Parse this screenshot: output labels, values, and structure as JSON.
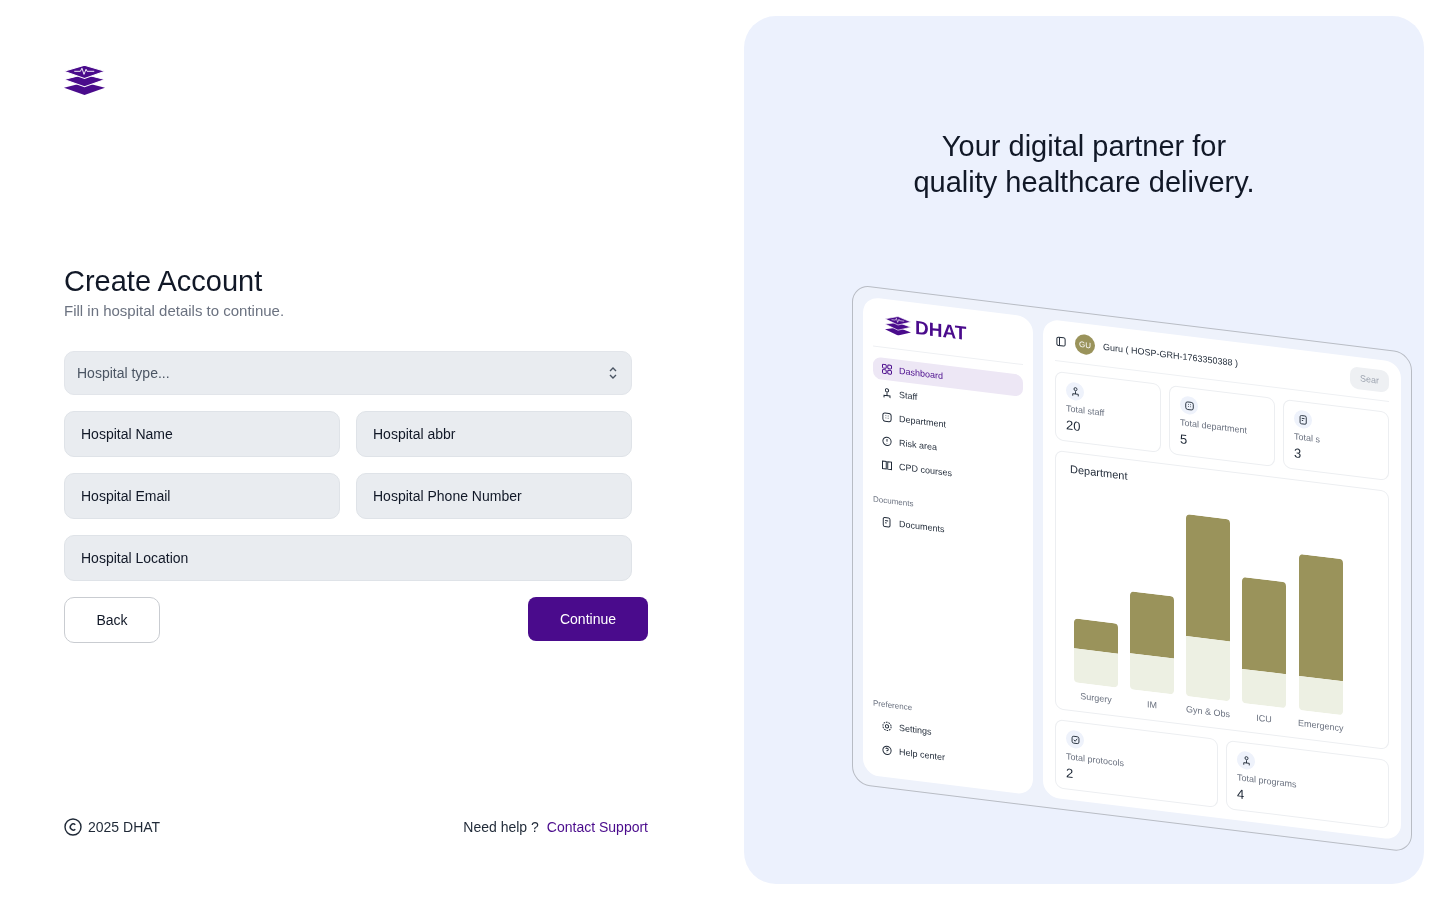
{
  "form": {
    "title": "Create Account",
    "subtitle": "Fill in hospital details to continue.",
    "select": {
      "placeholder": "Hospital type..."
    },
    "fields": [
      {
        "placeholder": "Hospital Name"
      },
      {
        "placeholder": "Hospital abbr"
      },
      {
        "placeholder": "Hospital Email"
      },
      {
        "placeholder": "Hospital Phone Number"
      },
      {
        "placeholder": "Hospital Location"
      }
    ],
    "back": "Back",
    "continue": "Continue"
  },
  "footer": {
    "copyright": "2025 DHAT",
    "help": "Need help ?",
    "link": "Contact Support"
  },
  "promo": {
    "tagline": [
      "Your digital partner for",
      "quality healthcare delivery."
    ],
    "preview": {
      "brand": "DHAT",
      "nav": [
        {
          "label": "Dashboard",
          "selected": true
        },
        {
          "label": "Staff",
          "selected": false
        },
        {
          "label": "Department",
          "selected": false
        },
        {
          "label": "Risk area",
          "selected": false
        },
        {
          "label": "CPD courses",
          "selected": false
        }
      ],
      "documents_heading": "Documents",
      "documents": [
        {
          "label": "Documents",
          "selected": false
        }
      ],
      "preference_heading": "Preference",
      "preference": [
        {
          "label": "Settings",
          "selected": false
        },
        {
          "label": "Help center",
          "selected": false
        }
      ],
      "avatar": "GU",
      "user": "Guru ( HOSP-GRH-1763350388 )",
      "search": "Sear",
      "stats": [
        {
          "label": "Total staff",
          "value": "20"
        },
        {
          "label": "Total department",
          "value": "5"
        },
        {
          "label": "Total s",
          "value": "3"
        }
      ],
      "chart_title": "Department",
      "bars": [
        {
          "label": "Surgery"
        },
        {
          "label": "IM"
        },
        {
          "label": "Gyn & Obs"
        },
        {
          "label": "ICU"
        },
        {
          "label": "Emergency"
        }
      ],
      "bottom_stats": [
        {
          "label": "Total protocols",
          "value": "2"
        },
        {
          "label": "Total programs",
          "value": "4"
        }
      ]
    }
  }
}
